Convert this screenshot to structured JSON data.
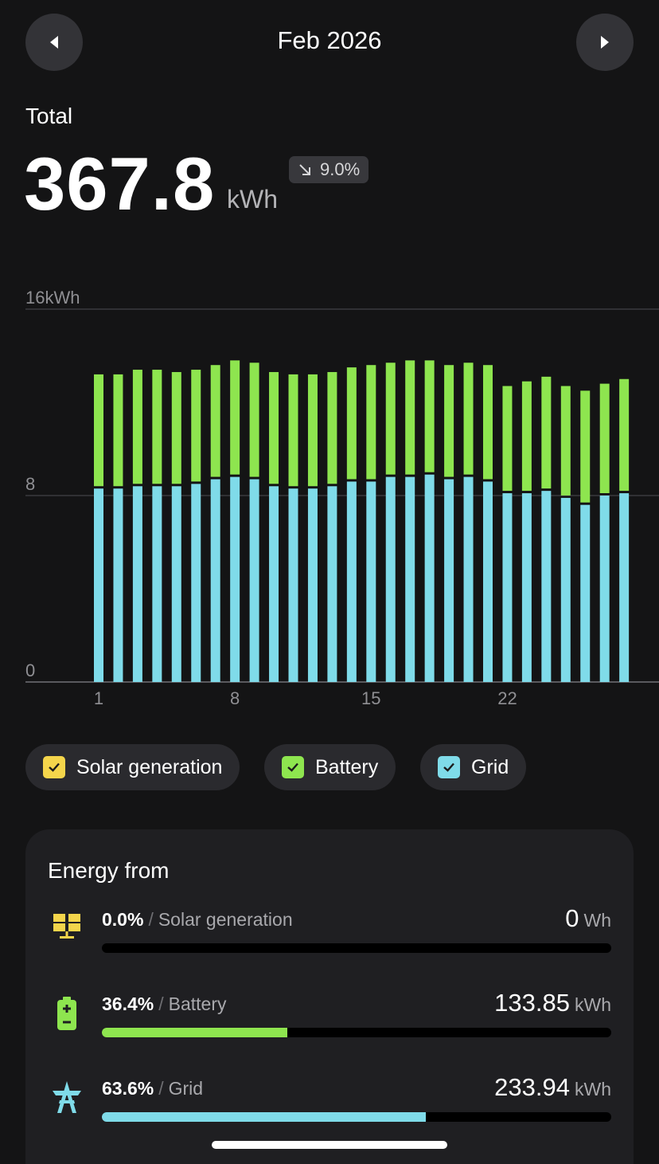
{
  "header": {
    "title": "Feb 2026",
    "prev_icon": "caret-left-icon",
    "next_icon": "caret-right-icon"
  },
  "summary": {
    "label": "Total",
    "value": "367.8",
    "unit": "kWh",
    "change": "9.0%",
    "change_icon": "arrow-down-right-icon"
  },
  "chart_data": {
    "type": "bar",
    "stacked": true,
    "ylim": [
      0,
      16
    ],
    "y_ticks": [
      "16kWh",
      "8",
      "0"
    ],
    "x_tick_labels": [
      "1",
      "8",
      "15",
      "22"
    ],
    "x_tick_days": [
      1,
      8,
      15,
      22
    ],
    "categories": [
      1,
      2,
      3,
      4,
      5,
      6,
      7,
      8,
      9,
      10,
      11,
      12,
      13,
      14,
      15,
      16,
      17,
      18,
      19,
      20,
      21,
      22,
      23,
      24,
      25,
      26,
      27,
      28
    ],
    "series": [
      {
        "name": "Grid",
        "color": "#7fdbe9",
        "values": [
          8.3,
          8.3,
          8.4,
          8.4,
          8.4,
          8.5,
          8.7,
          8.8,
          8.7,
          8.4,
          8.3,
          8.3,
          8.4,
          8.6,
          8.6,
          8.8,
          8.8,
          8.9,
          8.7,
          8.8,
          8.6,
          8.1,
          8.1,
          8.2,
          7.9,
          7.6,
          8.0,
          8.1
        ]
      },
      {
        "name": "Battery",
        "color": "#8ee54f",
        "values": [
          4.9,
          4.9,
          5.0,
          5.0,
          4.9,
          4.9,
          4.9,
          5.0,
          5.0,
          4.9,
          4.9,
          4.9,
          4.9,
          4.9,
          5.0,
          4.9,
          5.0,
          4.9,
          4.9,
          4.9,
          5.0,
          4.6,
          4.8,
          4.9,
          4.8,
          4.9,
          4.8,
          4.9
        ]
      }
    ],
    "grid_lines": true
  },
  "legend": [
    {
      "label": "Solar generation",
      "color": "#f4d54b"
    },
    {
      "label": "Battery",
      "color": "#8ee54f"
    },
    {
      "label": "Grid",
      "color": "#7fdbe9"
    }
  ],
  "energy_from": {
    "title": "Energy from",
    "sources": [
      {
        "pct": "0.0%",
        "name": "Solar generation",
        "value": "0",
        "unit": "Wh",
        "fraction": 0.0,
        "color": "#f4d54b",
        "icon": "solar-panel-icon"
      },
      {
        "pct": "36.4%",
        "name": "Battery",
        "value": "133.85",
        "unit": "kWh",
        "fraction": 0.364,
        "color": "#8ee54f",
        "icon": "battery-icon"
      },
      {
        "pct": "63.6%",
        "name": "Grid",
        "value": "233.94",
        "unit": "kWh",
        "fraction": 0.636,
        "color": "#7fdbe9",
        "icon": "power-tower-icon"
      }
    ]
  }
}
